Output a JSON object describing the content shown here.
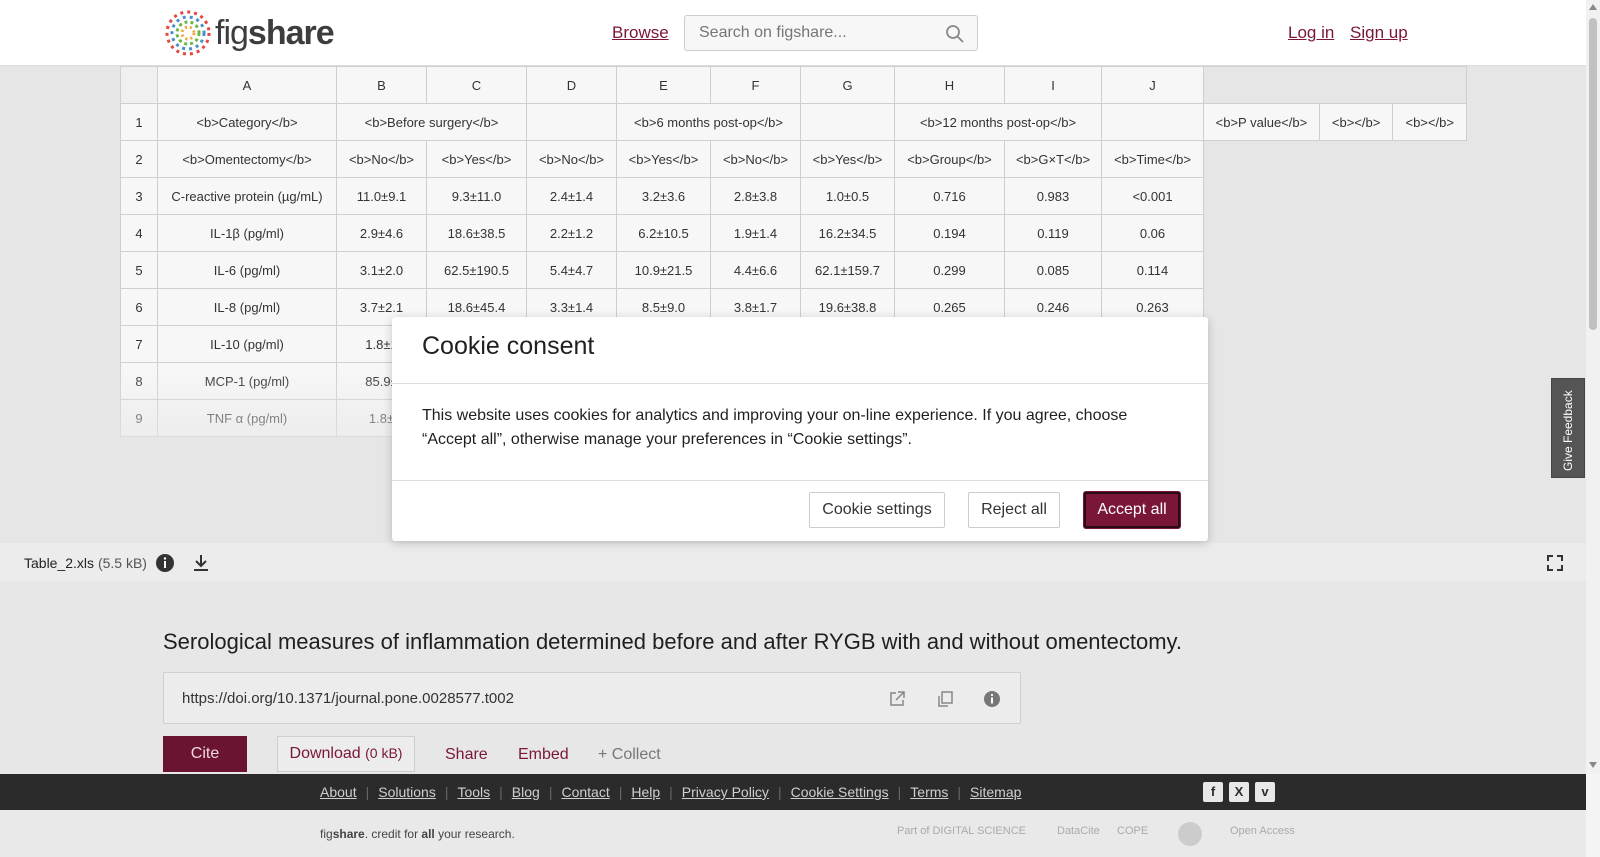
{
  "header": {
    "logo_text_light": "fig",
    "logo_text_bold": "share",
    "browse": "Browse",
    "search_placeholder": "Search on figshare...",
    "login": "Log in",
    "signup": "Sign up"
  },
  "sheet": {
    "col_headers": [
      "A",
      "B",
      "C",
      "D",
      "E",
      "F",
      "G",
      "H",
      "I",
      "J"
    ],
    "rows": [
      {
        "n": "1",
        "cells": [
          "<b>Category</b>",
          "<b>Before surgery</b>",
          "",
          "<b>6 months post-op</b>",
          "",
          "<b>12 months post-op</b>",
          "",
          "<b>P value</b>",
          "<b></b>",
          "<b></b>"
        ]
      },
      {
        "n": "2",
        "cells": [
          "<b>Omentectomy</b>",
          "<b>No</b>",
          "<b>Yes</b>",
          "<b>No</b>",
          "<b>Yes</b>",
          "<b>No</b>",
          "<b>Yes</b>",
          "<b>Group</b>",
          "<b>G×T</b>",
          "<b>Time</b>"
        ]
      },
      {
        "n": "3",
        "cells": [
          "C-reactive protein (µg/mL)",
          "11.0±9.1",
          "9.3±11.0",
          "2.4±1.4",
          "3.2±3.6",
          "2.8±3.8",
          "1.0±0.5",
          "0.716",
          "0.983",
          "<0.001"
        ]
      },
      {
        "n": "4",
        "cells": [
          "IL-1β (pg/ml)",
          "2.9±4.6",
          "18.6±38.5",
          "2.2±1.2",
          "6.2±10.5",
          "1.9±1.4",
          "16.2±34.5",
          "0.194",
          "0.119",
          "0.06"
        ]
      },
      {
        "n": "5",
        "cells": [
          "IL-6 (pg/ml)",
          "3.1±2.0",
          "62.5±190.5",
          "5.4±4.7",
          "10.9±21.5",
          "4.4±6.6",
          "62.1±159.7",
          "0.299",
          "0.085",
          "0.114"
        ]
      },
      {
        "n": "6",
        "cells": [
          "IL-8 (pg/ml)",
          "3.7±2.1",
          "18.6±45.4",
          "3.3±1.4",
          "8.5±9.0",
          "3.8±1.7",
          "19.6±38.8",
          "0.265",
          "0.246",
          "0.263"
        ]
      },
      {
        "n": "7",
        "cells": [
          "IL-10 (pg/ml)",
          "1.8±1",
          "",
          "",
          "",
          "",
          "",
          "",
          "",
          ""
        ]
      },
      {
        "n": "8",
        "cells": [
          "MCP-1 (pg/ml)",
          "85.9±",
          "",
          "",
          "",
          "",
          "",
          "",
          "",
          ""
        ]
      },
      {
        "n": "9",
        "cells": [
          "TNF α (pg/ml)",
          "1.8±",
          "",
          "",
          "",
          "",
          "",
          "",
          "",
          ""
        ]
      }
    ]
  },
  "filebar": {
    "filename": "Table_2.xls",
    "size": "(5.5 kB)"
  },
  "item": {
    "title": "Serological measures of inflammation determined before and after RYGB with and without omentectomy.",
    "doi": "https://doi.org/10.1371/journal.pone.0028577.t002",
    "cite": "Cite",
    "download": "Download",
    "download_size": "(0 kB)",
    "share": "Share",
    "embed": "Embed",
    "collect": "+ Collect"
  },
  "footer": {
    "links": [
      "About",
      "Solutions",
      "Tools",
      "Blog",
      "Contact",
      "Help",
      "Privacy Policy",
      "Cookie Settings",
      "Terms",
      "Sitemap"
    ],
    "tagline_light": "fig",
    "tagline_bold": "share",
    "tagline_rest": ". credit for ",
    "tagline_all": "all",
    "tagline_end": " your research.",
    "partners": [
      "Part of DIGITAL SCIENCE",
      "DataCite",
      "COPE",
      "",
      "Open Access"
    ]
  },
  "feedback": "Give Feedback",
  "cookie": {
    "title": "Cookie consent",
    "body": "This website uses cookies for analytics and improving your on-line experience. If you agree, choose “Accept all”, otherwise manage your preferences in “Cookie settings”.",
    "settings": "Cookie settings",
    "reject": "Reject all",
    "accept": "Accept all"
  },
  "colors": {
    "brand": "#7a1637",
    "cite_bg": "#6a1432",
    "footer_bg": "#2b2b2b"
  }
}
